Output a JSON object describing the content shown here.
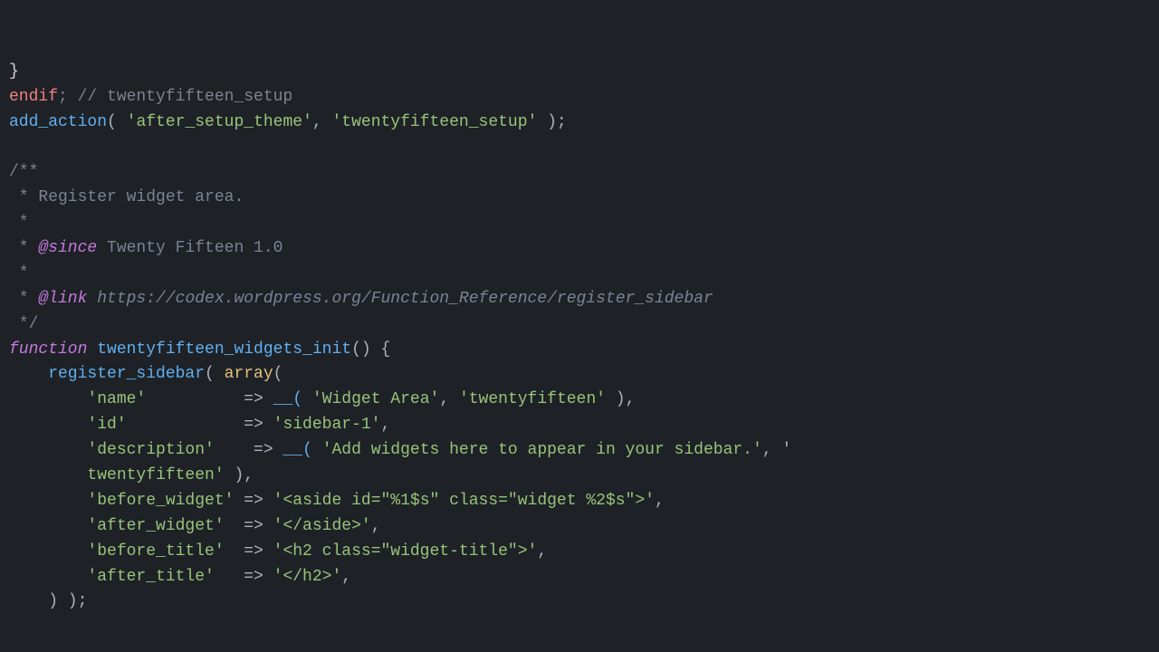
{
  "editor": {
    "background": "#1e2227",
    "lines": [
      {
        "id": 1,
        "tokens": [
          {
            "text": "}",
            "class": "c-brace"
          }
        ]
      },
      {
        "id": 2,
        "tokens": [
          {
            "text": "endif",
            "class": "c-red"
          },
          {
            "text": "; // twentyfifteen_setup",
            "class": "c-comment"
          }
        ]
      },
      {
        "id": 3,
        "tokens": [
          {
            "text": "add_action",
            "class": "c-func"
          },
          {
            "text": "( ",
            "class": "c-plain"
          },
          {
            "text": "'after_setup_theme'",
            "class": "c-string"
          },
          {
            "text": ", ",
            "class": "c-plain"
          },
          {
            "text": "'twentyfifteen_setup'",
            "class": "c-string"
          },
          {
            "text": " );",
            "class": "c-plain"
          }
        ]
      },
      {
        "id": 4,
        "tokens": []
      },
      {
        "id": 5,
        "tokens": [
          {
            "text": "/**",
            "class": "c-comment"
          }
        ]
      },
      {
        "id": 6,
        "tokens": [
          {
            "text": " * Register widget area.",
            "class": "c-comment"
          }
        ]
      },
      {
        "id": 7,
        "tokens": [
          {
            "text": " *",
            "class": "c-comment"
          }
        ]
      },
      {
        "id": 8,
        "tokens": [
          {
            "text": " * ",
            "class": "c-comment"
          },
          {
            "text": "@since",
            "class": "c-doclink"
          },
          {
            "text": " Twenty Fifteen 1.0",
            "class": "c-comment"
          }
        ]
      },
      {
        "id": 9,
        "tokens": [
          {
            "text": " *",
            "class": "c-comment"
          }
        ]
      },
      {
        "id": 10,
        "tokens": [
          {
            "text": " * ",
            "class": "c-comment"
          },
          {
            "text": "@link",
            "class": "c-doclink"
          },
          {
            "text": " https://codex.wordpress.org/Function_Reference/register_sidebar",
            "class": "c-docurl"
          }
        ]
      },
      {
        "id": 11,
        "tokens": [
          {
            "text": " */",
            "class": "c-comment"
          }
        ]
      },
      {
        "id": 12,
        "tokens": [
          {
            "text": "function",
            "class": "c-keyword"
          },
          {
            "text": " twentyfifteen_widgets_init",
            "class": "c-func"
          },
          {
            "text": "() {",
            "class": "c-plain"
          }
        ]
      },
      {
        "id": 13,
        "tokens": [
          {
            "text": "    register_sidebar",
            "class": "c-func"
          },
          {
            "text": "( ",
            "class": "c-plain"
          },
          {
            "text": "array",
            "class": "c-array"
          },
          {
            "text": "(",
            "class": "c-plain"
          }
        ]
      },
      {
        "id": 14,
        "tokens": [
          {
            "text": "        'name'",
            "class": "c-string"
          },
          {
            "text": "          => ",
            "class": "c-plain"
          },
          {
            "text": "__(",
            "class": "c-func"
          },
          {
            "text": " ",
            "class": "c-plain"
          },
          {
            "text": "'Widget Area'",
            "class": "c-string"
          },
          {
            "text": ", ",
            "class": "c-plain"
          },
          {
            "text": "'twentyfifteen'",
            "class": "c-string"
          },
          {
            "text": " ),",
            "class": "c-plain"
          }
        ]
      },
      {
        "id": 15,
        "tokens": [
          {
            "text": "        'id'",
            "class": "c-string"
          },
          {
            "text": "            => ",
            "class": "c-plain"
          },
          {
            "text": "'sidebar-1'",
            "class": "c-string"
          },
          {
            "text": ",",
            "class": "c-plain"
          }
        ]
      },
      {
        "id": 16,
        "tokens": [
          {
            "text": "        'description'",
            "class": "c-string"
          },
          {
            "text": "    => ",
            "class": "c-plain"
          },
          {
            "text": "__(",
            "class": "c-func"
          },
          {
            "text": " ",
            "class": "c-plain"
          },
          {
            "text": "'Add widgets here to appear in your sidebar.'",
            "class": "c-string"
          },
          {
            "text": ", '",
            "class": "c-plain"
          }
        ]
      },
      {
        "id": 17,
        "tokens": [
          {
            "text": "        twentyfifteen'",
            "class": "c-string"
          },
          {
            "text": " ),",
            "class": "c-plain"
          }
        ]
      },
      {
        "id": 18,
        "tokens": [
          {
            "text": "        'before_widget'",
            "class": "c-string"
          },
          {
            "text": " => ",
            "class": "c-plain"
          },
          {
            "text": "'<aside id=\"%1$s\" class=\"widget %2$s\">'",
            "class": "c-string"
          },
          {
            "text": ",",
            "class": "c-plain"
          }
        ]
      },
      {
        "id": 19,
        "tokens": [
          {
            "text": "        'after_widget'",
            "class": "c-string"
          },
          {
            "text": "  => ",
            "class": "c-plain"
          },
          {
            "text": "'</aside>'",
            "class": "c-string"
          },
          {
            "text": ",",
            "class": "c-plain"
          }
        ]
      },
      {
        "id": 20,
        "tokens": [
          {
            "text": "        'before_title'",
            "class": "c-string"
          },
          {
            "text": "  => ",
            "class": "c-plain"
          },
          {
            "text": "'<h2 class=\"widget-title\">'",
            "class": "c-string"
          },
          {
            "text": ",",
            "class": "c-plain"
          }
        ]
      },
      {
        "id": 21,
        "tokens": [
          {
            "text": "        'after_title'",
            "class": "c-string"
          },
          {
            "text": "   => ",
            "class": "c-plain"
          },
          {
            "text": "'</h2>'",
            "class": "c-string"
          },
          {
            "text": ",",
            "class": "c-plain"
          }
        ]
      },
      {
        "id": 22,
        "tokens": [
          {
            "text": "    ) );",
            "class": "c-plain"
          }
        ]
      }
    ]
  }
}
